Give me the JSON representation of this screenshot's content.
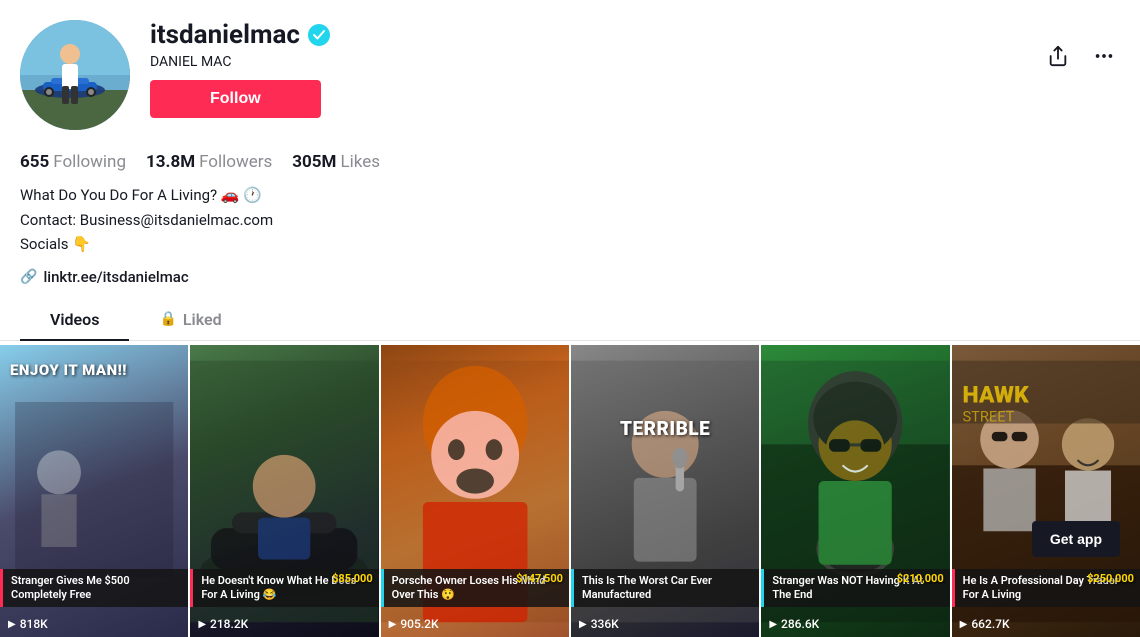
{
  "profile": {
    "username": "itsdanielmac",
    "display_name": "DANIEL MAC",
    "verified": true,
    "follow_label": "Follow",
    "stats": {
      "following_count": "655",
      "following_label": "Following",
      "followers_count": "13.8M",
      "followers_label": "Followers",
      "likes_count": "305M",
      "likes_label": "Likes"
    },
    "bio": [
      "What Do You Do For A Living? 🚗 🕐",
      "Contact: Business@itsdanielmac.com",
      "Socials 👇"
    ],
    "link": "linktr.ee/itsdanielmac"
  },
  "tabs": [
    {
      "id": "videos",
      "label": "Videos",
      "active": true,
      "locked": false
    },
    {
      "id": "liked",
      "label": "Liked",
      "active": false,
      "locked": true
    }
  ],
  "videos": [
    {
      "id": 1,
      "overlay_text": "ENJOY IT MAN!!",
      "caption": "Stranger Gives Me $500 Completely Free",
      "caption_style": "pink",
      "views": "818K",
      "bg_class": "vid1-bg"
    },
    {
      "id": 2,
      "overlay_text": "",
      "caption": "He Doesn't Know What He Does For A Living 😂",
      "caption_style": "pink",
      "views": "218.2K",
      "price": "$85,000",
      "bg_class": "vid2-bg"
    },
    {
      "id": 3,
      "overlay_text": "",
      "caption": "Porsche Owner Loses His Mind Over This 😲",
      "caption_style": "cyan",
      "views": "905.2K",
      "price": "$147,500",
      "bg_class": "vid3-bg"
    },
    {
      "id": 4,
      "overlay_text": "TERRIBLE",
      "caption": "This Is The Worst Car Ever Manufactured",
      "caption_style": "cyan",
      "views": "336K",
      "bg_class": "vid4-bg"
    },
    {
      "id": 5,
      "overlay_text": "",
      "caption": "Stranger Was NOT Having It At The End",
      "caption_style": "cyan",
      "views": "286.6K",
      "price": "$210,000",
      "bg_class": "vid5-bg"
    },
    {
      "id": 6,
      "overlay_text": "",
      "caption": "He Is A Professional Day Trader For A Living",
      "caption_style": "pink",
      "views": "662.7K",
      "price": "$250,000",
      "bg_class": "vid6-bg"
    }
  ],
  "get_app": {
    "label": "Get app"
  }
}
